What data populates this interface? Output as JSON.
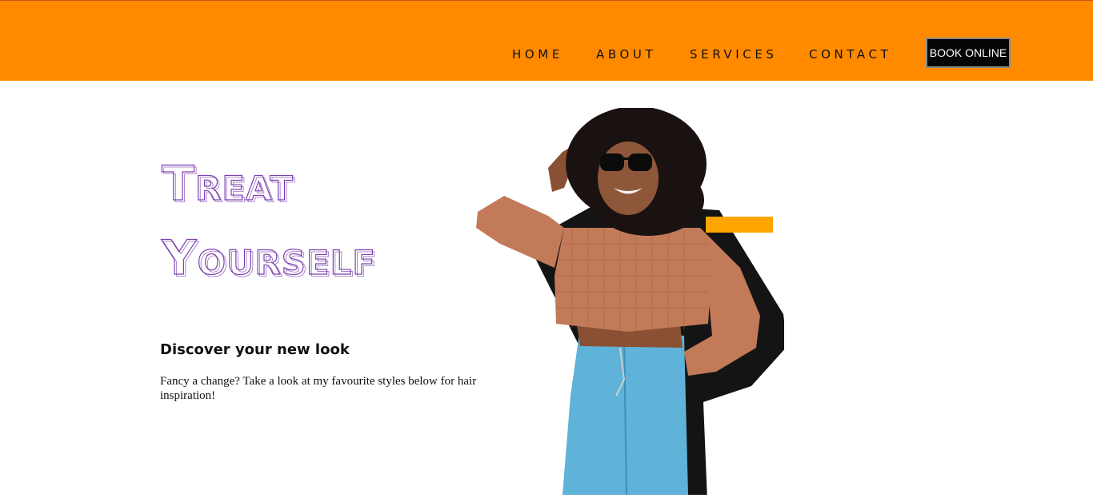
{
  "nav": {
    "items": [
      {
        "label": "HOME"
      },
      {
        "label": "ABOUT"
      },
      {
        "label": "SERVICES"
      },
      {
        "label": "CONTACT"
      }
    ],
    "book_label": "BOOK ONLINE"
  },
  "hero": {
    "title_line1": "Treat",
    "title_line2": "Yourself",
    "subheading": "Discover your new look",
    "paragraph": "Fancy a change? Take a look at my favourite styles below for hair inspiration!"
  },
  "colors": {
    "header_bg": "#ff8a00",
    "title_purple": "#7b3fb0",
    "accent": "#ffa500",
    "button_bg": "#050505"
  },
  "icons": {
    "photo": "woman-sunglasses-peace-sign-photo"
  }
}
